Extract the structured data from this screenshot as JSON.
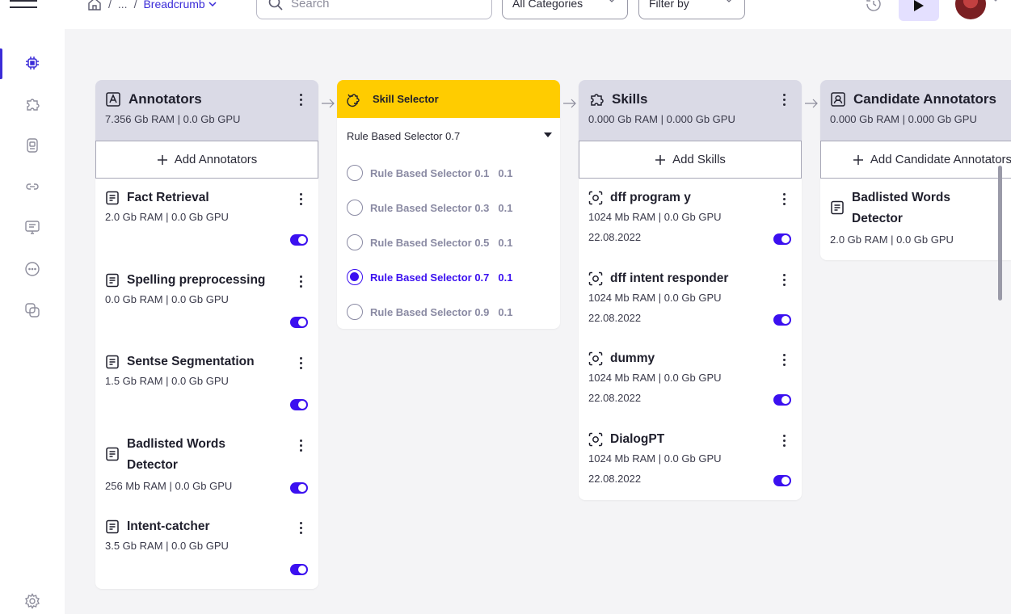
{
  "header": {
    "breadcrumb": {
      "sep1": "/",
      "ellipsis": "...",
      "sep2": "/",
      "current": "Breadcrumb"
    },
    "search_placeholder": "Search",
    "category_select": "All Categories",
    "filter_select": "Filter by"
  },
  "annotators": {
    "title": "Annotators",
    "resources": "7.356 Gb RAM | 0.0 Gb GPU",
    "add_label": "Add Annotators",
    "items": [
      {
        "name": "Fact Retrieval",
        "resources": "2.0 Gb RAM  |  0.0 Gb GPU",
        "enabled": true
      },
      {
        "name": "Spelling preprocessing",
        "resources": "0.0 Gb RAM  |  0.0 Gb GPU",
        "enabled": true
      },
      {
        "name": "Sentse Segmentation",
        "resources": "1.5 Gb RAM  |  0.0 Gb GPU",
        "enabled": true
      },
      {
        "name": "Badlisted Words Detector",
        "resources": "256 Mb RAM  |  0.0 Gb GPU",
        "enabled": true
      },
      {
        "name": "Intent-catcher",
        "resources": "3.5 Gb RAM  |  0.0 Gb GPU",
        "enabled": true
      }
    ]
  },
  "skill_selector": {
    "title": "Skill Selector",
    "selected": "Rule Based Selector 0.7",
    "options": [
      {
        "label": "Rule Based Selector 0.1",
        "weight": "0.1",
        "checked": false
      },
      {
        "label": "Rule Based Selector 0.3",
        "weight": "0.1",
        "checked": false
      },
      {
        "label": "Rule Based Selector 0.5",
        "weight": "0.1",
        "checked": false
      },
      {
        "label": "Rule Based Selector 0.7",
        "weight": "0.1",
        "checked": true
      },
      {
        "label": "Rule Based Selector 0.9",
        "weight": "0.1",
        "checked": false
      }
    ]
  },
  "skills": {
    "title": "Skills",
    "resources": "0.000 Gb RAM | 0.000 Gb GPU",
    "add_label": "Add Skills",
    "items": [
      {
        "name": "dff program y",
        "resources": "1024 Mb RAM  |  0.0 Gb GPU",
        "date": "22.08.2022",
        "enabled": true
      },
      {
        "name": "dff intent responder",
        "resources": "1024 Mb RAM  |  0.0 Gb GPU",
        "date": "22.08.2022",
        "enabled": true
      },
      {
        "name": "dummy",
        "resources": "1024 Mb RAM  |  0.0 Gb GPU",
        "date": "22.08.2022",
        "enabled": true
      },
      {
        "name": "DialogPT",
        "resources": "1024 Mb RAM  |  0.0 Gb GPU",
        "date": "22.08.2022",
        "enabled": true
      }
    ]
  },
  "candidate_annotators": {
    "title": "Candidate Annotators",
    "resources": "0.000 Gb RAM | 0.000 Gb GPU",
    "add_label": "Add Candidate Annotators",
    "items": [
      {
        "name": "Badlisted Words Detector",
        "resources": "2.0 Gb RAM  |  0.0 Gb GPU"
      }
    ]
  },
  "colors": {
    "accent": "#3b10f0",
    "selector_header": "#ffcc00",
    "column_header": "#dadae6"
  }
}
